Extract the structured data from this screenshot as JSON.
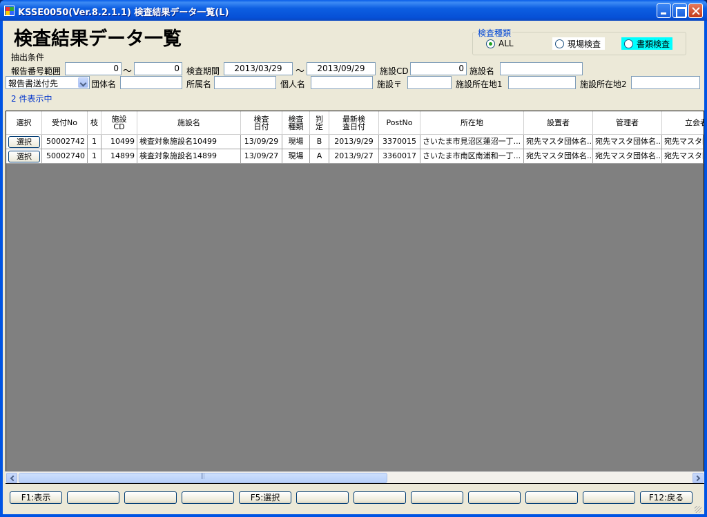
{
  "window": {
    "title": "KSSE0050(Ver.8.2.1.1) 検査結果データ一覧(L)"
  },
  "page_title": "検査結果データ一覧",
  "filters": {
    "section_label": "抽出条件",
    "report_no_label": "報告番号範囲",
    "report_no_from": "0",
    "report_no_to": "0",
    "tilde": "～",
    "period_label": "検査期間",
    "period_from": "2013/03/29",
    "period_to": "2013/09/29",
    "facility_cd_label": "施設CD",
    "facility_cd": "0",
    "facility_name_label": "施設名",
    "facility_name": "",
    "destination_select": "報告書送付先",
    "group_name_label": "団体名",
    "group_name": "",
    "affiliation_label": "所属名",
    "affiliation": "",
    "person_label": "個人名",
    "person": "",
    "postal_label": "施設〒",
    "postal": "",
    "address1_label": "施設所在地1",
    "address1": "",
    "address2_label": "施設所在地2",
    "address2": "",
    "count_text": "2 件表示中"
  },
  "inspection_type": {
    "title": "検査種類",
    "options": [
      {
        "label": "ALL",
        "selected": true
      },
      {
        "label": "現場検査",
        "selected": false
      },
      {
        "label": "書類検査",
        "selected": false
      }
    ],
    "highlight_color": "#00ffff"
  },
  "grid": {
    "headers": [
      "選択",
      "受付No",
      "枝",
      "施設\nCD",
      "施設名",
      "検査\n日付",
      "検査\n種類",
      "判\n定",
      "最新検\n査日付",
      "PostNo",
      "所在地",
      "設置者",
      "管理者",
      "立会者"
    ],
    "rows": [
      {
        "button": "選択",
        "receipt_no": "50002742",
        "branch": "1",
        "facility_cd": "10499",
        "facility_name": "検査対象施設名10499",
        "inspection_date": "13/09/29",
        "type": "現場",
        "result": "B",
        "latest_date": "2013/9/29",
        "postno": "3370015",
        "address": "さいたま市見沼区蓮沼一丁...",
        "installer": "宛先マスタ団体名...",
        "manager": "宛先マスタ団体名...",
        "witness": "宛先マスタ団"
      },
      {
        "button": "選択",
        "receipt_no": "50002740",
        "branch": "1",
        "facility_cd": "14899",
        "facility_name": "検査対象施設名14899",
        "inspection_date": "13/09/27",
        "type": "現場",
        "result": "A",
        "latest_date": "2013/9/27",
        "postno": "3360017",
        "address": "さいたま市南区南浦和一丁...",
        "installer": "宛先マスタ団体名...",
        "manager": "宛先マスタ団体名...",
        "witness": "宛先マスタ団"
      }
    ]
  },
  "function_keys": [
    "F1:表示",
    "",
    "",
    "",
    "F5:選択",
    "",
    "",
    "",
    "",
    "",
    "",
    "F12:戻る"
  ]
}
